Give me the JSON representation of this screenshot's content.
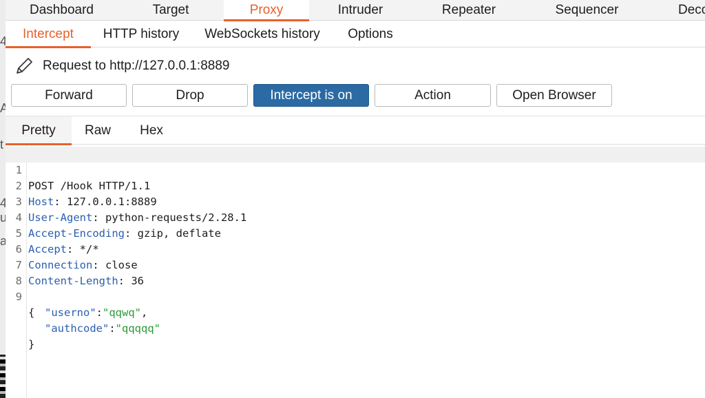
{
  "top_tabs": [
    "Dashboard",
    "Target",
    "Proxy",
    "Intruder",
    "Repeater",
    "Sequencer",
    "Deco"
  ],
  "active_top_tab": "Proxy",
  "sub_tabs": [
    "Intercept",
    "HTTP history",
    "WebSockets history",
    "Options"
  ],
  "active_sub_tab": "Intercept",
  "request_label": "Request to http://127.0.0.1:8889",
  "buttons": {
    "forward": "Forward",
    "drop": "Drop",
    "intercept": "Intercept is on",
    "action": "Action",
    "open_browser": "Open Browser"
  },
  "editor_tabs": [
    "Pretty",
    "Raw",
    "Hex"
  ],
  "active_editor_tab": "Pretty",
  "request_lines": [
    {
      "n": "1",
      "plain": "POST /Hook HTTP/1.1"
    },
    {
      "n": "2",
      "key": "Host",
      "val": " 127.0.0.1:8889"
    },
    {
      "n": "3",
      "key": "User-Agent",
      "val": " python-requests/2.28.1"
    },
    {
      "n": "4",
      "key": "Accept-Encoding",
      "val": " gzip, deflate"
    },
    {
      "n": "5",
      "key": "Accept",
      "val": " */*"
    },
    {
      "n": "6",
      "key": "Connection",
      "val": " close"
    },
    {
      "n": "7",
      "key": "Content-Length",
      "val": " 36"
    },
    {
      "n": "8",
      "plain": ""
    },
    {
      "n": "9",
      "plain": "{"
    }
  ],
  "json_body": [
    {
      "key": "\"userno\"",
      "sep": ":",
      "val": "\"qqwq\"",
      "end": ","
    },
    {
      "key": "\"authcode\"",
      "sep": ":",
      "val": "\"qqqqq\"",
      "end": ""
    }
  ],
  "closing_brace": "}",
  "colors": {
    "accent": "#e8602c",
    "primary_button": "#2b6aa3",
    "header_key": "#2a5fb0",
    "json_string": "#2b9a37"
  },
  "icons": {
    "request_icon": "pencil-icon"
  }
}
